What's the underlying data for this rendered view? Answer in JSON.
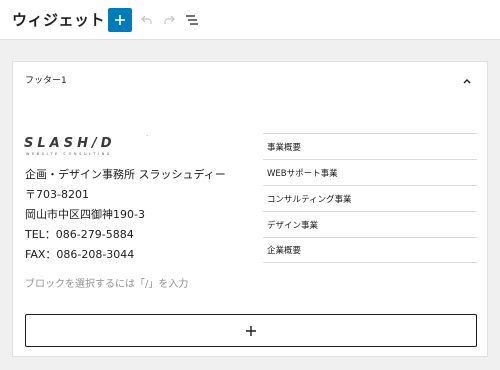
{
  "header": {
    "title": "ウィジェット"
  },
  "panel": {
    "title": "フッター1"
  },
  "footer_info": {
    "company": "企画・デザイン事務所 スラッシュディー",
    "zip": "〒703-8201",
    "address": "岡山市中区四御神190-3",
    "tel": "TEL：086-279-5884",
    "fax": "FAX：086-208-3044",
    "block_placeholder": "ブロックを選択するには「/」を入力"
  },
  "logo": {
    "brand": "SLASH/D",
    "tagline": "WEBSITE CONSULTING"
  },
  "menu": {
    "items": [
      {
        "label": "事業概要"
      },
      {
        "label": "WEBサポート事業"
      },
      {
        "label": "コンサルティング事業"
      },
      {
        "label": "デザイン事業"
      },
      {
        "label": "企業概要"
      }
    ]
  },
  "colors": {
    "accent": "#007cba",
    "border": "#e0e0e0",
    "background": "#f0f0f1"
  },
  "icons": {
    "add": "plus-icon",
    "undo": "undo-icon",
    "redo": "redo-icon",
    "outline": "list-view-icon",
    "collapse": "chevron-up-icon",
    "appender": "plus-icon"
  }
}
